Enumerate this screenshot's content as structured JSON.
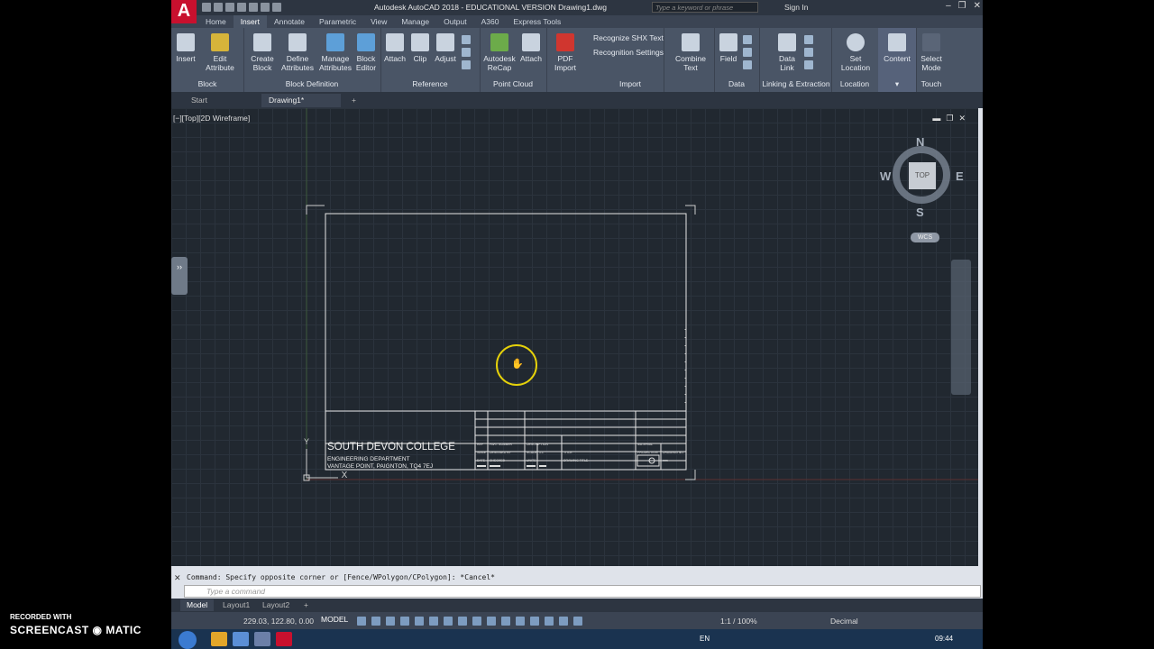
{
  "window": {
    "title": "Autodesk AutoCAD 2018 - EDUCATIONAL VERSION    Drawing1.dwg",
    "search_placeholder": "Type a keyword or phrase",
    "sign_in": "Sign In",
    "logo": "A"
  },
  "menu_tabs": [
    "Home",
    "Insert",
    "Annotate",
    "Parametric",
    "View",
    "Manage",
    "Output",
    "A360",
    "Express Tools"
  ],
  "ribbon": {
    "block": {
      "label": "Block",
      "buttons": [
        "Insert",
        "Edit Attribute"
      ]
    },
    "block_definition": {
      "label": "Block Definition",
      "buttons": [
        "Create Block",
        "Define Attributes",
        "Manage Attributes",
        "Block Editor"
      ]
    },
    "reference": {
      "label": "Reference",
      "buttons": [
        "Attach",
        "Clip",
        "Adjust"
      ]
    },
    "point_cloud": {
      "label": "Point Cloud",
      "buttons": [
        "Autodesk ReCap",
        "Attach"
      ]
    },
    "import": {
      "label": "Import",
      "buttons": [
        "PDF Import"
      ],
      "items": [
        "Recognize SHX Text",
        "Recognition Settings"
      ]
    },
    "text": {
      "buttons": [
        "Combine Text"
      ]
    },
    "data": {
      "label": "Data",
      "buttons": [
        "Field"
      ]
    },
    "linking": {
      "label": "Linking & Extraction",
      "buttons": [
        "Data Link"
      ]
    },
    "location": {
      "label": "Location",
      "buttons": [
        "Set Location"
      ]
    },
    "content": {
      "buttons": [
        "Content"
      ]
    },
    "touch": {
      "label": "Touch",
      "buttons": [
        "Select Mode"
      ]
    }
  },
  "doc_tabs": [
    "Start",
    "Drawing1*"
  ],
  "viewport": {
    "label": "[−][Top][2D Wireframe]",
    "viewcube": {
      "top": "TOP",
      "north": "N",
      "south": "S",
      "east": "E",
      "west": "W",
      "wcs": "WCS"
    }
  },
  "title_block": {
    "college": "SOUTH DEVON COLLEGE",
    "dept": "ENGINEERING DEPARTMENT",
    "address": "VANTAGE POINT, PAIGNTON, TQ4 7EJ",
    "cells": [
      "REF",
      "PART NUMBER",
      "DESCRIPTION",
      "MATERIAL",
      "NAME",
      "DESIGNED BY",
      "SCALE",
      "1:1",
      "TITLE",
      "PROJECTION",
      "DRAWING NO.",
      "DATE",
      "CHECKED",
      "UNITS",
      "DRAWING TITLE",
      "mm"
    ]
  },
  "command": {
    "history": "Command: Specify opposite corner or [Fence/WPolygon/CPolygon]: *Cancel*",
    "placeholder": "Type a command"
  },
  "layout_tabs": [
    "Model",
    "Layout1",
    "Layout2"
  ],
  "status": {
    "coords": "229.03, 122.80, 0.00",
    "model": "MODEL",
    "scale": "1:1 / 100%",
    "units": "Decimal"
  },
  "overlay": {
    "recorded": "RECORDED WITH",
    "brand": "SCREENCAST ◉ MATIC"
  },
  "taskbar": {
    "language": "EN",
    "time": "09:44"
  },
  "colors": {
    "canvas": "#212830",
    "ribbon": "#4a5566",
    "cursor": "#e5d10a",
    "logo": "#c8102e"
  }
}
